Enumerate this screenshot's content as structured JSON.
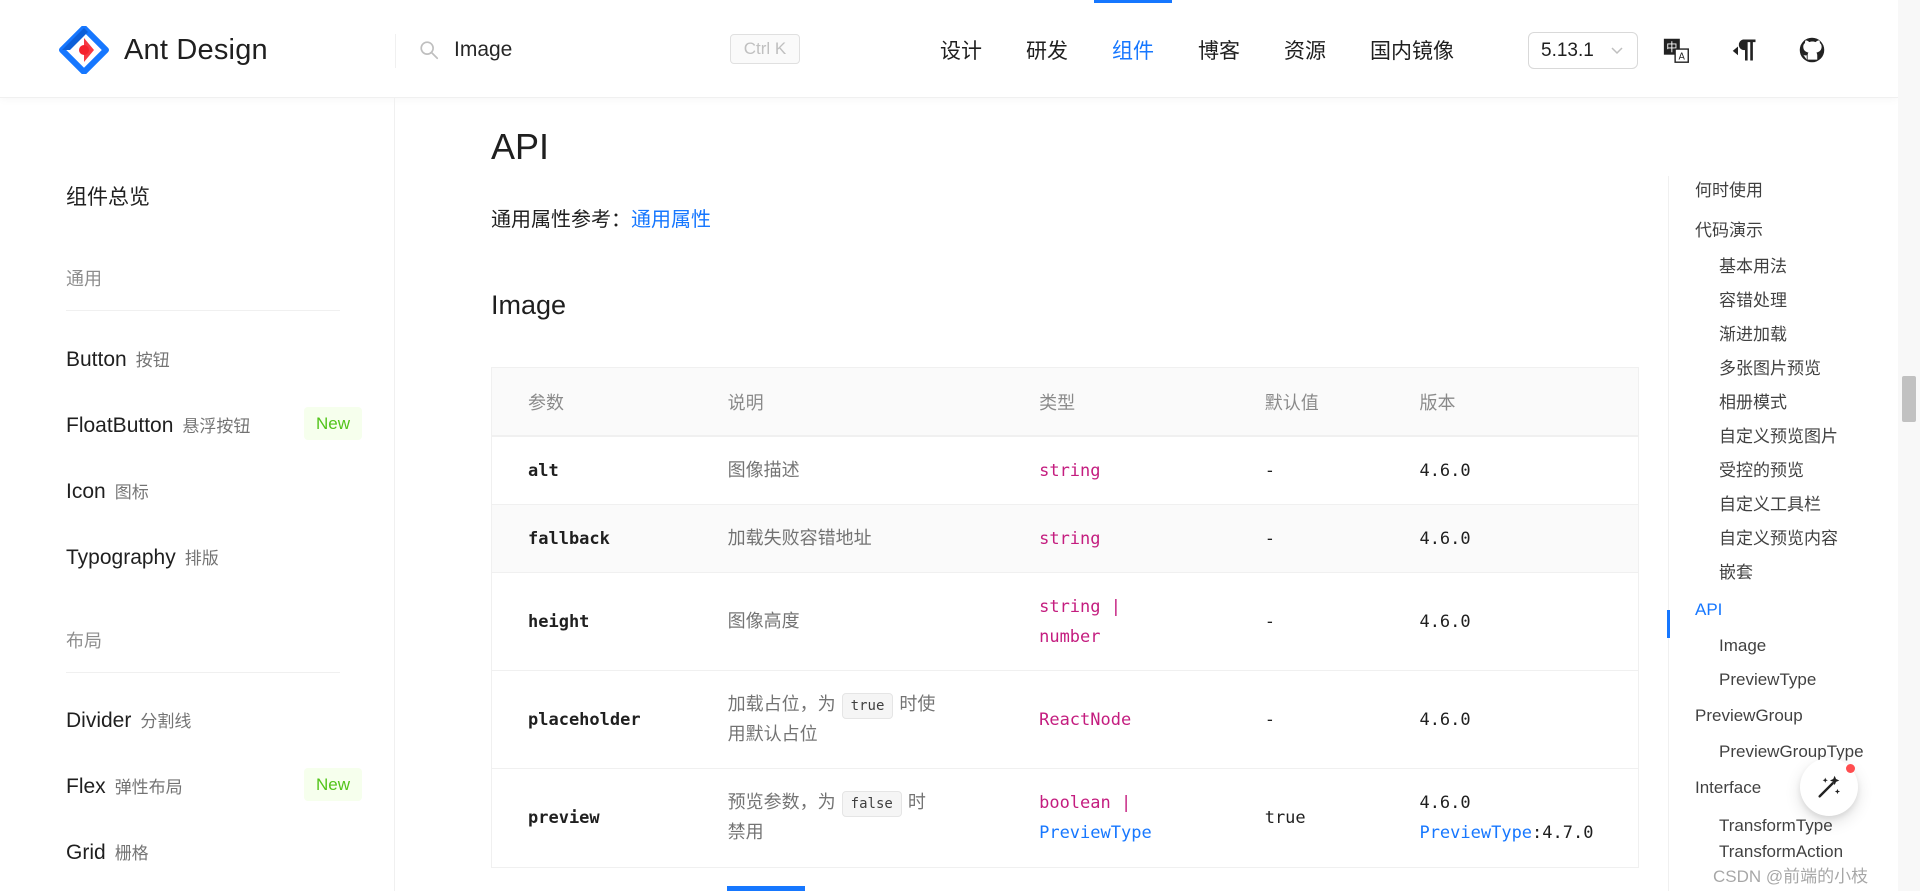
{
  "header": {
    "brand": "Ant Design",
    "search_value": "Image",
    "search_shortcut": "Ctrl K",
    "nav": [
      {
        "label": "设计",
        "active": false
      },
      {
        "label": "研发",
        "active": false
      },
      {
        "label": "组件",
        "active": true
      },
      {
        "label": "博客",
        "active": false
      },
      {
        "label": "资源",
        "active": false
      },
      {
        "label": "国内镜像",
        "active": false
      }
    ],
    "version": "5.13.1",
    "icons": [
      "language-switch-icon",
      "rtl-direction-icon",
      "github-icon"
    ],
    "accent_color": "#1677ff"
  },
  "sidebar": {
    "overview": "组件总览",
    "groups": [
      {
        "title": "通用",
        "items": [
          {
            "en": "Button",
            "cn": "按钮",
            "badge": ""
          },
          {
            "en": "FloatButton",
            "cn": "悬浮按钮",
            "badge": "New"
          },
          {
            "en": "Icon",
            "cn": "图标",
            "badge": ""
          },
          {
            "en": "Typography",
            "cn": "排版",
            "badge": ""
          }
        ]
      },
      {
        "title": "布局",
        "items": [
          {
            "en": "Divider",
            "cn": "分割线",
            "badge": ""
          },
          {
            "en": "Flex",
            "cn": "弹性布局",
            "badge": "New"
          },
          {
            "en": "Grid",
            "cn": "栅格",
            "badge": ""
          }
        ]
      }
    ]
  },
  "main": {
    "title": "API",
    "common_props_prefix": "通用属性参考：",
    "common_props_link": "通用属性",
    "section_title": "Image",
    "table": {
      "headers": [
        "参数",
        "说明",
        "类型",
        "默认值",
        "版本"
      ],
      "rows": [
        {
          "name": "alt",
          "desc": "图像描述",
          "type": [
            "string"
          ],
          "default": "-",
          "version": [
            "4.6.0"
          ]
        },
        {
          "name": "fallback",
          "desc": "加载失败容错地址",
          "type": [
            "string"
          ],
          "default": "-",
          "version": [
            "4.6.0"
          ]
        },
        {
          "name": "height",
          "desc": "图像高度",
          "type": [
            "string |",
            "number"
          ],
          "default": "-",
          "version": [
            "4.6.0"
          ]
        },
        {
          "name": "placeholder",
          "desc_pre": "加载占位，为",
          "desc_code": "true",
          "desc_post1": "时使",
          "desc_post2": "用默认占位",
          "type": [
            "ReactNode"
          ],
          "default": "-",
          "version": [
            "4.6.0"
          ]
        },
        {
          "name": "preview",
          "desc_pre": "预览参数，为",
          "desc_code": "false",
          "desc_post1": "时",
          "desc_post2": "禁用",
          "type": [
            "boolean |",
            "PreviewType"
          ],
          "default": "true",
          "version": [
            "4.6.0"
          ],
          "version_link": "PreviewType",
          "version_suffix": ":4.7.0"
        }
      ]
    }
  },
  "toc": {
    "items": [
      {
        "label": "何时使用",
        "level": 1
      },
      {
        "label": "代码演示",
        "level": 1
      },
      {
        "label": "基本用法",
        "level": 2
      },
      {
        "label": "容错处理",
        "level": 2
      },
      {
        "label": "渐进加载",
        "level": 2
      },
      {
        "label": "多张图片预览",
        "level": 2
      },
      {
        "label": "相册模式",
        "level": 2
      },
      {
        "label": "自定义预览图片",
        "level": 2
      },
      {
        "label": "受控的预览",
        "level": 2
      },
      {
        "label": "自定义工具栏",
        "level": 2
      },
      {
        "label": "自定义预览内容",
        "level": 2
      },
      {
        "label": "嵌套",
        "level": 2
      },
      {
        "label": "API",
        "level": 1,
        "active": true
      },
      {
        "label": "Image",
        "level": 2
      },
      {
        "label": "PreviewType",
        "level": 2
      },
      {
        "label": "PreviewGroup",
        "level": 1
      },
      {
        "label": "PreviewGroupType",
        "level": 2
      },
      {
        "label": "Interface",
        "level": 1
      },
      {
        "label": "TransformType",
        "level": 2
      },
      {
        "label": "TransformAction",
        "level": 2
      }
    ]
  },
  "watermark": "CSDN @前端的小枝"
}
